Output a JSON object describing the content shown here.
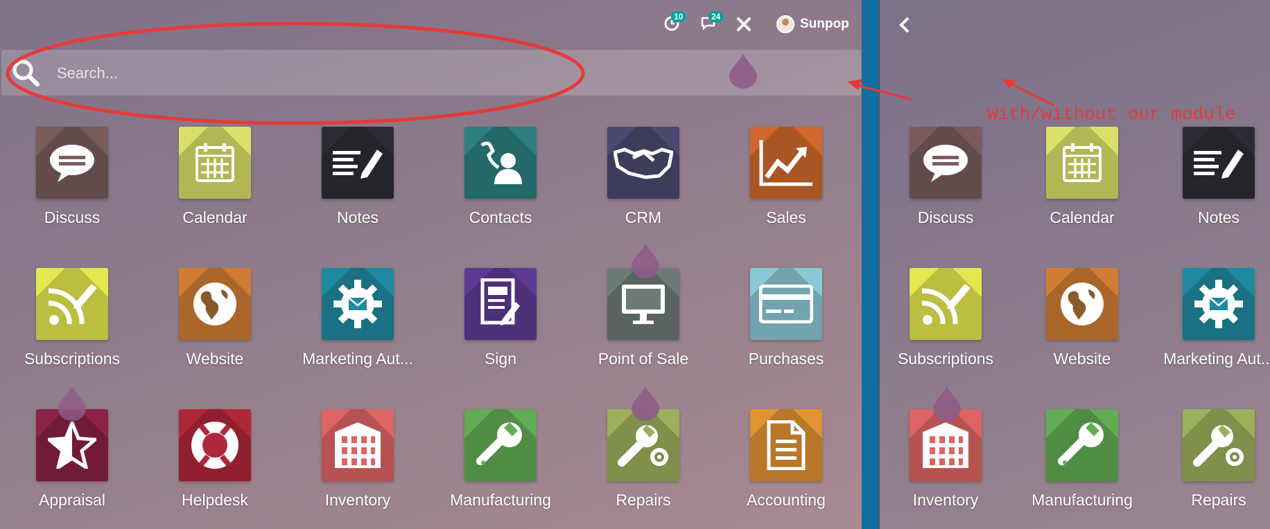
{
  "topbar": {
    "activity_count": "10",
    "messages_count": "24",
    "user_name": "Sunpop"
  },
  "search": {
    "placeholder": "Search..."
  },
  "annotation": "With/without our module",
  "colors": {
    "red_annotation": "#e63a3a",
    "divider": "#0f6f9e",
    "badge": "#00a09d"
  },
  "left_apps": [
    {
      "label": "Discuss",
      "icon": "chat-bubble-icon",
      "color": "#7a5c5c"
    },
    {
      "label": "Calendar",
      "icon": "calendar-icon",
      "color": "#d9e06a"
    },
    {
      "label": "Notes",
      "icon": "notes-pencil-icon",
      "color": "#2c2c35"
    },
    {
      "label": "Contacts",
      "icon": "contact-phone-icon",
      "color": "#2e7f80"
    },
    {
      "label": "CRM",
      "icon": "handshake-icon",
      "color": "#4b4a6e"
    },
    {
      "label": "Sales",
      "icon": "trend-chart-icon",
      "color": "#d0682c"
    },
    {
      "label": "Subscriptions",
      "icon": "rss-pencil-icon",
      "color": "#e5e84d"
    },
    {
      "label": "Website",
      "icon": "globe-icon",
      "color": "#d07c33"
    },
    {
      "label": "Marketing Aut...",
      "icon": "gear-mail-icon",
      "color": "#1f8aa0"
    },
    {
      "label": "Sign",
      "icon": "document-sign-icon",
      "color": "#5e3a95"
    },
    {
      "label": "Point of Sale",
      "icon": "monitor-icon",
      "color": "#6d7a78"
    },
    {
      "label": "Purchases",
      "icon": "credit-card-icon",
      "color": "#8ac9d6"
    },
    {
      "label": "Appraisal",
      "icon": "star-icon",
      "color": "#8c2245"
    },
    {
      "label": "Helpdesk",
      "icon": "lifebuoy-icon",
      "color": "#b1273a"
    },
    {
      "label": "Inventory",
      "icon": "warehouse-icon",
      "color": "#de6464"
    },
    {
      "label": "Manufacturing",
      "icon": "wrench-icon",
      "color": "#62ad54"
    },
    {
      "label": "Repairs",
      "icon": "wrench-gear-icon",
      "color": "#9ab05a"
    },
    {
      "label": "Accounting",
      "icon": "document-lines-icon",
      "color": "#e19233"
    }
  ],
  "right_apps": [
    {
      "label": "Discuss",
      "icon": "chat-bubble-icon",
      "color": "#7a5c5c"
    },
    {
      "label": "Calendar",
      "icon": "calendar-icon",
      "color": "#d9e06a"
    },
    {
      "label": "Notes",
      "icon": "notes-pencil-icon",
      "color": "#2c2c35"
    },
    {
      "label": "Subscriptions",
      "icon": "rss-pencil-icon",
      "color": "#e5e84d"
    },
    {
      "label": "Website",
      "icon": "globe-icon",
      "color": "#d07c33"
    },
    {
      "label": "Marketing Aut...",
      "icon": "gear-mail-icon",
      "color": "#1f8aa0"
    },
    {
      "label": "Inventory",
      "icon": "warehouse-icon",
      "color": "#de6464"
    },
    {
      "label": "Manufacturing",
      "icon": "wrench-icon",
      "color": "#62ad54"
    },
    {
      "label": "Repairs",
      "icon": "wrench-gear-icon",
      "color": "#9ab05a"
    }
  ]
}
